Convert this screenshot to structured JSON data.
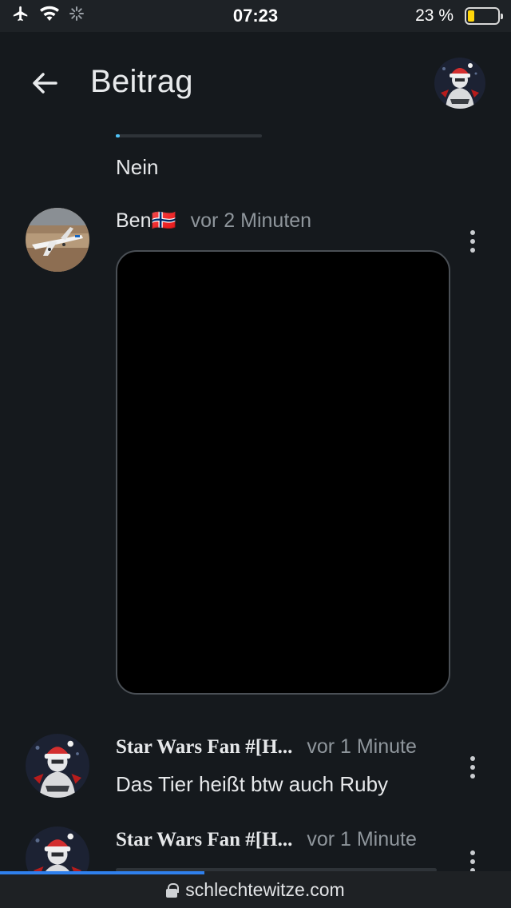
{
  "status_bar": {
    "time": "07:23",
    "battery_text": "23 %",
    "battery_level": 0.23,
    "icons": [
      "airplane-icon",
      "wifi-icon",
      "loading-spinner-icon",
      "battery-icon"
    ]
  },
  "header": {
    "title": "Beitrag",
    "back_icon": "arrow-left-icon"
  },
  "thread": {
    "previous_reply": "Nein",
    "posts": [
      {
        "author": "Ben🇳🇴",
        "time": "vor 2 Minuten",
        "media": "dark-image"
      },
      {
        "author": "Star Wars Fan #[H...",
        "time": "vor 1 Minute",
        "text": "Das Tier heißt btw auch Ruby"
      },
      {
        "author": "Star Wars Fan #[H...",
        "time": "vor 1 Minute"
      }
    ]
  },
  "browser": {
    "url": "schlechtewitze.com",
    "load_progress": 0.4
  },
  "colors": {
    "background": "#15191d",
    "accent_progress": "#4fc3f7",
    "browser_load": "#2f80ed",
    "battery": "#ffd60a"
  }
}
